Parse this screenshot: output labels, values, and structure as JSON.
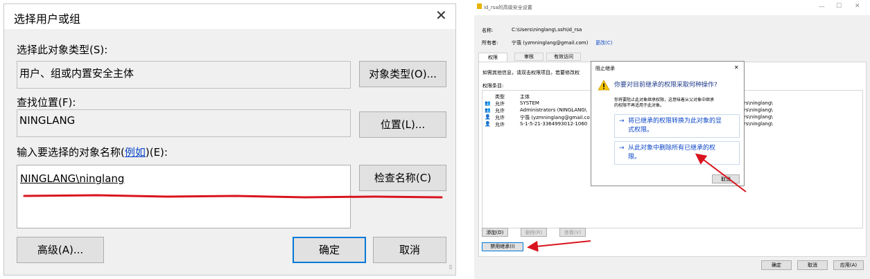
{
  "left": {
    "title": "选择用户或组",
    "object_type_label": "选择此对象类型(S):",
    "object_type_value": "用户、组或内置安全主体",
    "object_type_button": "对象类型(O)...",
    "location_label": "查找位置(F):",
    "location_value": "NINGLANG",
    "location_button": "位置(L)...",
    "enter_name_label_pre": "输入要选择的对象名称(",
    "enter_name_link": "例如",
    "enter_name_label_post": ")(E):",
    "enter_name_value": "NINGLANG\\ninglang",
    "check_names_button": "检查名称(C)",
    "advanced_button": "高级(A)...",
    "ok_button": "确定",
    "cancel_button": "取消"
  },
  "right": {
    "window_title": "id_rsa的高级安全设置",
    "name_label": "名称:",
    "name_value": "C:\\Users\\ninglang\\.ssh\\id_rsa",
    "owner_label": "所有者:",
    "owner_value": "宁蒗 (yzmninglang@gmail.com)",
    "owner_change": "更改(C)",
    "tabs": [
      "权限",
      "审核",
      "有效访问"
    ],
    "info_text": "如需其他信息，请双击权限项目。若要修改权",
    "entries_label": "权限条目:",
    "col_type": "类型",
    "col_principal": "主体",
    "rows": [
      {
        "type": "允许",
        "principal": "SYSTEM",
        "inherit": "rs\\ninglang\\"
      },
      {
        "type": "允许",
        "principal": "Administrators (NINGLANG\\",
        "inherit": "rs\\ninglang\\"
      },
      {
        "type": "允许",
        "principal": "宁蒗 (yzmninglang@gmail.co",
        "inherit": "rs\\ninglang\\"
      },
      {
        "type": "允许",
        "principal": "S-1-5-21-3364993012-1060",
        "inherit": "rs\\ninglang\\"
      }
    ],
    "add_button": "添加(D)",
    "remove_button": "删除(R)",
    "view_button": "查看(V)",
    "disable_inherit_button": "禁用继承(I)",
    "ok_button": "确定",
    "cancel_button": "取消",
    "apply_button": "应用(A)"
  },
  "popup": {
    "title": "阻止继承",
    "question": "你要对目前继承的权限采取何种操作?",
    "description_line1": "你将要阻止此对象继承权限，这意味着从父对象中继承",
    "description_line2": "的权限不再适用于此对象。",
    "option1_line1": "将已继承的权限转换为此对象的显",
    "option1_line2": "式权限。",
    "option2_line1": "从此对象中删除所有已继承的权",
    "option2_line2": "限。",
    "cancel_button": "取消"
  },
  "colors": {
    "annotation_red": "#d9141e",
    "link_blue": "#0b46c8",
    "default_button_border": "#0078d7"
  }
}
